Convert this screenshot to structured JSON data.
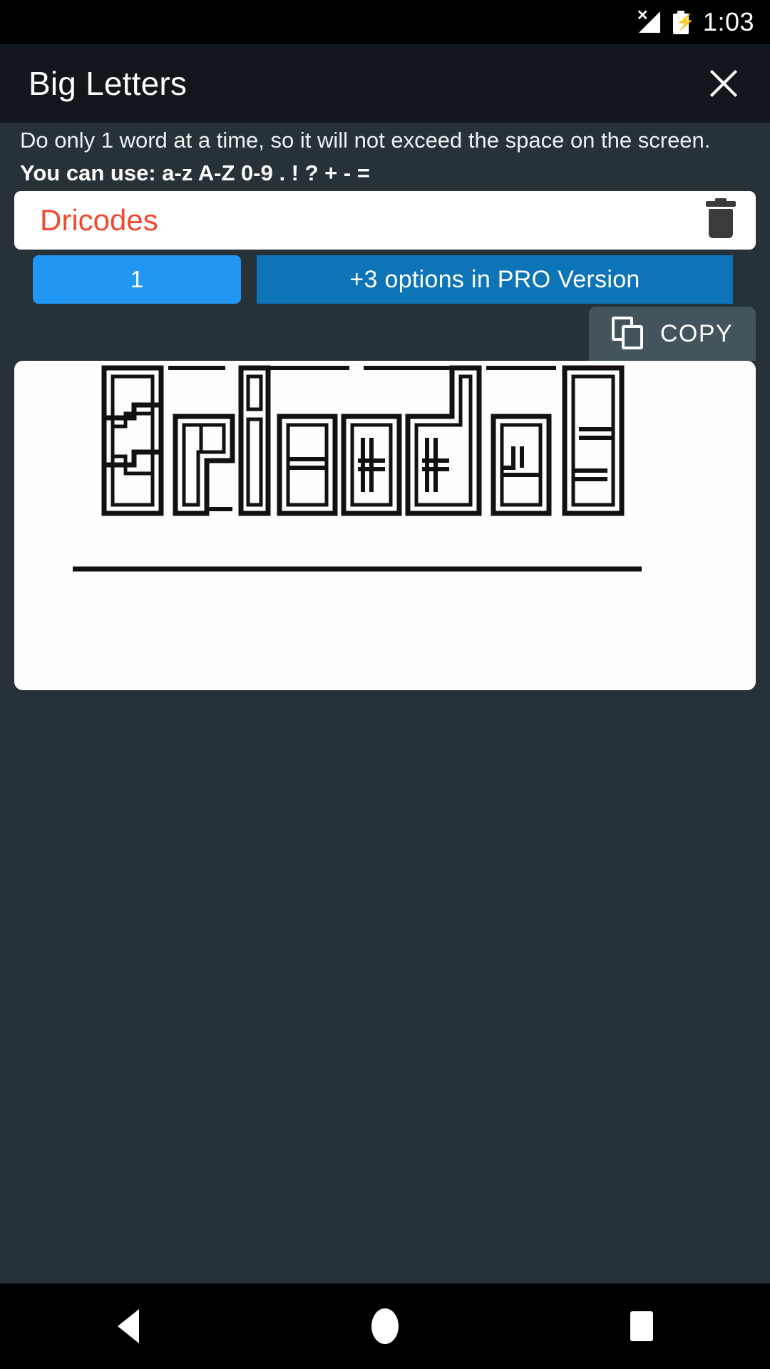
{
  "status_bar": {
    "time": "1:03",
    "signal_icon": "signal-no-sim-icon",
    "battery_icon": "battery-charging-icon"
  },
  "title_bar": {
    "title": "Big Letters",
    "close_icon": "close-icon"
  },
  "instructions": {
    "line1": "Do only 1 word at a time, so it will not exceed the space on the screen.",
    "line2": "You can use: a-z A-Z 0-9 . ! ? + - ="
  },
  "input": {
    "value": "Dricodes",
    "placeholder": "",
    "text_color": "#f04a33",
    "clear_icon": "trash-icon"
  },
  "buttons": {
    "count_label": "1",
    "count_color": "#2196f3",
    "pro_label": "+3 options in PRO Version",
    "pro_color": "#0d74b8"
  },
  "copy_button": {
    "label": "COPY",
    "icon": "copy-icon",
    "background": "#44545d"
  },
  "canvas": {
    "rendered_word": "Dricodes",
    "style": "outline-ascii-art",
    "background": "#fdfdfb",
    "stroke_color": "#111111"
  },
  "nav_bar": {
    "back": "back-triangle-icon",
    "home": "home-circle-icon",
    "recents": "recents-square-icon"
  },
  "theme": {
    "page_background": "#263138",
    "title_background": "#12161d",
    "status_background": "#000000"
  }
}
